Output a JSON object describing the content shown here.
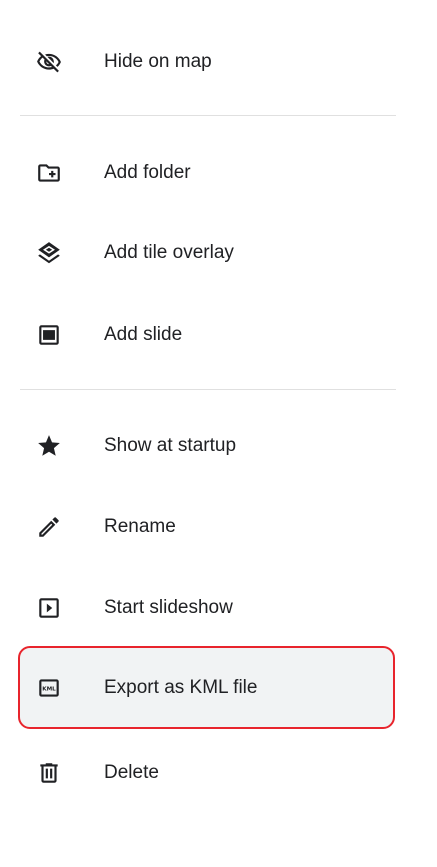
{
  "menu": {
    "items": [
      {
        "label": "Hide on map",
        "icon": "visibility-off-icon"
      },
      {
        "label": "Add folder",
        "icon": "add-folder-icon"
      },
      {
        "label": "Add tile overlay",
        "icon": "layers-icon"
      },
      {
        "label": "Add slide",
        "icon": "slide-icon"
      },
      {
        "label": "Show at startup",
        "icon": "star-icon"
      },
      {
        "label": "Rename",
        "icon": "pencil-icon"
      },
      {
        "label": "Start slideshow",
        "icon": "slideshow-play-icon"
      },
      {
        "label": "Export as KML file",
        "icon": "kml-file-icon",
        "highlighted": true
      },
      {
        "label": "Delete",
        "icon": "trash-icon"
      }
    ],
    "highlight_color": "#e8242c",
    "icon_color": "#202124"
  }
}
